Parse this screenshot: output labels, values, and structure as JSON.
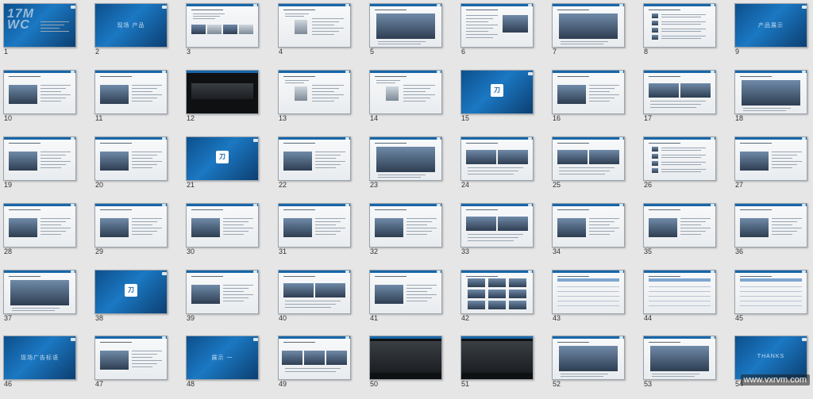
{
  "slides": [
    {
      "n": "1",
      "style": "cover",
      "text": "17M WC"
    },
    {
      "n": "2",
      "style": "blue",
      "text": "现场 产品"
    },
    {
      "n": "3",
      "style": "white-4img"
    },
    {
      "n": "4",
      "style": "white-diagram"
    },
    {
      "n": "5",
      "style": "white-img-wide"
    },
    {
      "n": "6",
      "style": "white-text-img"
    },
    {
      "n": "7",
      "style": "white-img-wide"
    },
    {
      "n": "8",
      "style": "white-list"
    },
    {
      "n": "9",
      "style": "blue",
      "text": "产品展示"
    },
    {
      "n": "10",
      "style": "white-img-left"
    },
    {
      "n": "11",
      "style": "white-img-left"
    },
    {
      "n": "12",
      "style": "dark-strip"
    },
    {
      "n": "13",
      "style": "white-diagram"
    },
    {
      "n": "14",
      "style": "white-diagram"
    },
    {
      "n": "15",
      "style": "blue-icon",
      "icon": "刀"
    },
    {
      "n": "16",
      "style": "white-img-left"
    },
    {
      "n": "17",
      "style": "white-2img"
    },
    {
      "n": "18",
      "style": "white-img-wide"
    },
    {
      "n": "19",
      "style": "white-img-left"
    },
    {
      "n": "20",
      "style": "white-img-left"
    },
    {
      "n": "21",
      "style": "blue-icon",
      "icon": "刀"
    },
    {
      "n": "22",
      "style": "white-img-left"
    },
    {
      "n": "23",
      "style": "white-img-wide"
    },
    {
      "n": "24",
      "style": "white-2img"
    },
    {
      "n": "25",
      "style": "white-2img"
    },
    {
      "n": "26",
      "style": "white-list"
    },
    {
      "n": "27",
      "style": "white-img-left"
    },
    {
      "n": "28",
      "style": "white-img-left"
    },
    {
      "n": "29",
      "style": "white-img-left"
    },
    {
      "n": "30",
      "style": "white-img-left"
    },
    {
      "n": "31",
      "style": "white-img-left"
    },
    {
      "n": "32",
      "style": "white-img-left"
    },
    {
      "n": "33",
      "style": "white-2img"
    },
    {
      "n": "34",
      "style": "white-img-left"
    },
    {
      "n": "35",
      "style": "white-img-left"
    },
    {
      "n": "36",
      "style": "white-img-left"
    },
    {
      "n": "37",
      "style": "white-img-wide"
    },
    {
      "n": "38",
      "style": "blue-icon",
      "icon": "刀"
    },
    {
      "n": "39",
      "style": "white-img-left"
    },
    {
      "n": "40",
      "style": "white-2img"
    },
    {
      "n": "41",
      "style": "white-img-left"
    },
    {
      "n": "42",
      "style": "white-grid"
    },
    {
      "n": "43",
      "style": "white-table"
    },
    {
      "n": "44",
      "style": "white-table"
    },
    {
      "n": "45",
      "style": "white-table"
    },
    {
      "n": "46",
      "style": "blue",
      "text": "现场广告标语"
    },
    {
      "n": "47",
      "style": "white-img-left"
    },
    {
      "n": "48",
      "style": "blue",
      "text": "展示 一"
    },
    {
      "n": "49",
      "style": "white-3img"
    },
    {
      "n": "50",
      "style": "dark"
    },
    {
      "n": "51",
      "style": "dark"
    },
    {
      "n": "52",
      "style": "white-img-wide"
    },
    {
      "n": "53",
      "style": "white-img-wide"
    },
    {
      "n": "54",
      "style": "blue",
      "text": "THANKS"
    }
  ],
  "watermark": "www.vxrvm.com",
  "colors": {
    "brand_blue": "#1766a8",
    "background": "#e6e6e6"
  }
}
